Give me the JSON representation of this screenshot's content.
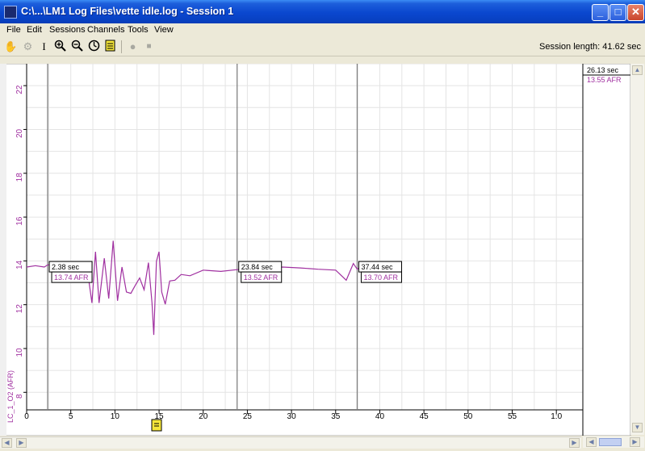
{
  "window": {
    "title": "C:\\...\\LM1 Log Files\\vette idle.log - Session 1",
    "buttons": {
      "minimize": "_",
      "maximize": "□",
      "close": "✕"
    }
  },
  "menu": [
    "File",
    "Edit",
    "Sessions",
    "Channels",
    "Tools",
    "View"
  ],
  "toolbar": {
    "tools": [
      "hand-icon",
      "gauge-icon",
      "text-cursor-icon",
      "zoom-in-icon",
      "zoom-out-icon",
      "zoom-reset-icon",
      "marker-icon",
      "record-icon",
      "stop-icon"
    ],
    "session_length": "Session length:  41.62 sec"
  },
  "chart_data": {
    "type": "line",
    "title": "",
    "xlabel": "",
    "ylabel": "LC_1_O2 (AFR)",
    "xlim": [
      0,
      63
    ],
    "ylim": [
      7.2,
      23
    ],
    "x_ticks": [
      "0",
      "5",
      "10",
      "15",
      "20",
      "25",
      "30",
      "35",
      "40",
      "45",
      "50",
      "55",
      "1:0"
    ],
    "y_ticks": [
      8,
      10,
      12,
      14,
      16,
      18,
      20,
      22
    ],
    "grid": true,
    "series": [
      {
        "name": "LC_1_O2 (AFR)",
        "color": "#a030a0",
        "x": [
          0,
          1,
          2,
          2.38,
          3,
          4,
          5,
          6,
          7,
          7.4,
          7.8,
          8.2,
          8.8,
          9.3,
          9.8,
          10.3,
          10.8,
          11.3,
          11.8,
          12.3,
          12.8,
          13.3,
          13.8,
          14.2,
          14.4,
          14.7,
          15.0,
          15.3,
          15.7,
          16.2,
          16.8,
          17.5,
          18.5,
          20,
          22,
          23.84,
          25,
          27,
          29,
          31,
          33,
          35,
          36.2,
          37,
          37.44,
          38,
          39.2
        ],
        "y": [
          13.8,
          13.7,
          13.8,
          13.74,
          13.9,
          13.6,
          13.4,
          13.4,
          13.3,
          12.0,
          14.5,
          12.0,
          14.2,
          12.2,
          15.0,
          12.1,
          13.8,
          12.5,
          12.6,
          12.8,
          13.3,
          12.6,
          14.0,
          12.0,
          10.7,
          13.9,
          14.5,
          12.5,
          12.1,
          13.0,
          13.2,
          13.3,
          13.4,
          13.5,
          13.6,
          13.52,
          13.7,
          13.6,
          13.8,
          13.6,
          13.7,
          13.5,
          13.2,
          13.8,
          13.7,
          13.7,
          13.8
        ]
      }
    ],
    "cursors": [
      {
        "time": "2.38 sec",
        "value": "13.74 AFR",
        "x": 2.38
      },
      {
        "time": "23.84 sec",
        "value": "13.52 AFR",
        "x": 23.84
      },
      {
        "time": "37.44 sec",
        "value": "13.70 AFR",
        "x": 37.44
      }
    ],
    "readout": {
      "time": "26.13 sec",
      "value": "13.55 AFR"
    }
  }
}
